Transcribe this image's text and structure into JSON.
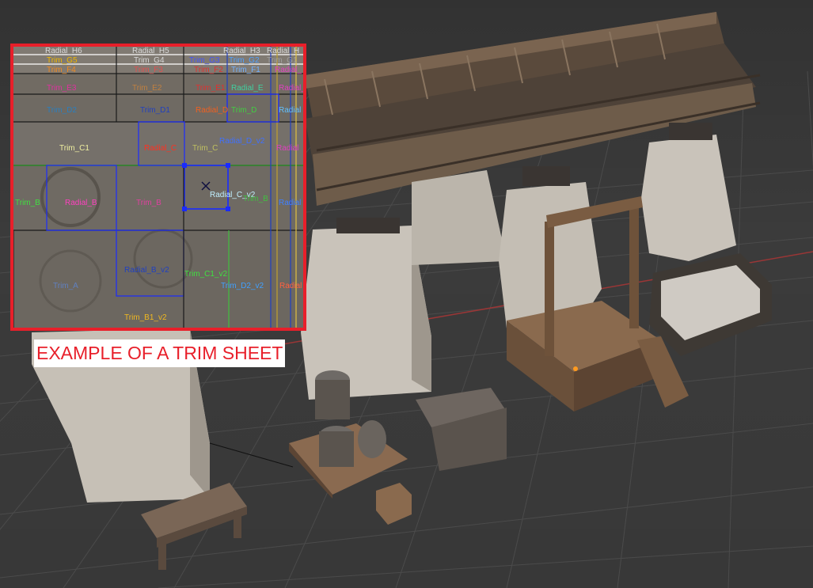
{
  "caption": "EXAMPLE OF A TRIM SHEET",
  "trim_sheet": {
    "labels": [
      {
        "text": "Radial_H6",
        "color": "#d9d9d9"
      },
      {
        "text": "Radial_H5",
        "color": "#d9d9d9"
      },
      {
        "text": "Radial_H3",
        "color": "#d9d9d9"
      },
      {
        "text": "Radial_H",
        "color": "#d9d9d9"
      },
      {
        "text": "Trim_G5",
        "color": "#f0b800"
      },
      {
        "text": "Trim_G4",
        "color": "#d9d9d9"
      },
      {
        "text": "Trim_G3",
        "color": "#4455ff"
      },
      {
        "text": "Trim_G2",
        "color": "#4fa0ff"
      },
      {
        "text": "Trim_G1",
        "color": "#a0a0a0"
      },
      {
        "text": "Trim_F4",
        "color": "#f08a20"
      },
      {
        "text": "Trim_F3",
        "color": "#e05050"
      },
      {
        "text": "Trim_F2",
        "color": "#e03030"
      },
      {
        "text": "Trim_F1",
        "color": "#70b0ff"
      },
      {
        "text": "Radial_",
        "color": "#e040c0"
      },
      {
        "text": "Trim_E3",
        "color": "#e030a0"
      },
      {
        "text": "Trim_E2",
        "color": "#c08040"
      },
      {
        "text": "Trim_E1",
        "color": "#e03030"
      },
      {
        "text": "Radial_E",
        "color": "#40d0a0"
      },
      {
        "text": "Radial_",
        "color": "#e040c0"
      },
      {
        "text": "Trim_D2",
        "color": "#2a7fbf"
      },
      {
        "text": "Trim_D1",
        "color": "#2040c0"
      },
      {
        "text": "Radial_D",
        "color": "#f06020"
      },
      {
        "text": "Trim_D",
        "color": "#40d040"
      },
      {
        "text": "Radial",
        "color": "#60c0ff"
      },
      {
        "text": "Trim_C1",
        "color": "#f0f0a0"
      },
      {
        "text": "Radial_C",
        "color": "#ff3020"
      },
      {
        "text": "Trim_C",
        "color": "#c0c060"
      },
      {
        "text": "Radial_D_v2",
        "color": "#4070ff"
      },
      {
        "text": "Radial",
        "color": "#e040c0"
      },
      {
        "text": "Trim_B",
        "color": "#40e040"
      },
      {
        "text": "Radial_B",
        "color": "#ff40c0"
      },
      {
        "text": "Trim_B",
        "color": "#e040a0"
      },
      {
        "text": "Radial_C_v2",
        "color": "#c0f0ff"
      },
      {
        "text": "Trim_B",
        "color": "#40c040"
      },
      {
        "text": "Radial",
        "color": "#4080ff"
      },
      {
        "text": "Radial_B_v2",
        "color": "#2040c0"
      },
      {
        "text": "Trim_A",
        "color": "#6080c0"
      },
      {
        "text": "Trim_C1_v2",
        "color": "#40e040"
      },
      {
        "text": "Trim_D2_v2",
        "color": "#40a0ff"
      },
      {
        "text": "Radial",
        "color": "#ff6040"
      },
      {
        "text": "Trim_B1_v2",
        "color": "#f0b820"
      }
    ]
  },
  "colors": {
    "accent_border": "#e81f2a",
    "caption_text": "#e81f2a",
    "viewport_bg": "#3b3b3b",
    "grid_line": "#4a4a4a",
    "axis_red": "#a83838",
    "uv_selection": "#1a2bff"
  }
}
